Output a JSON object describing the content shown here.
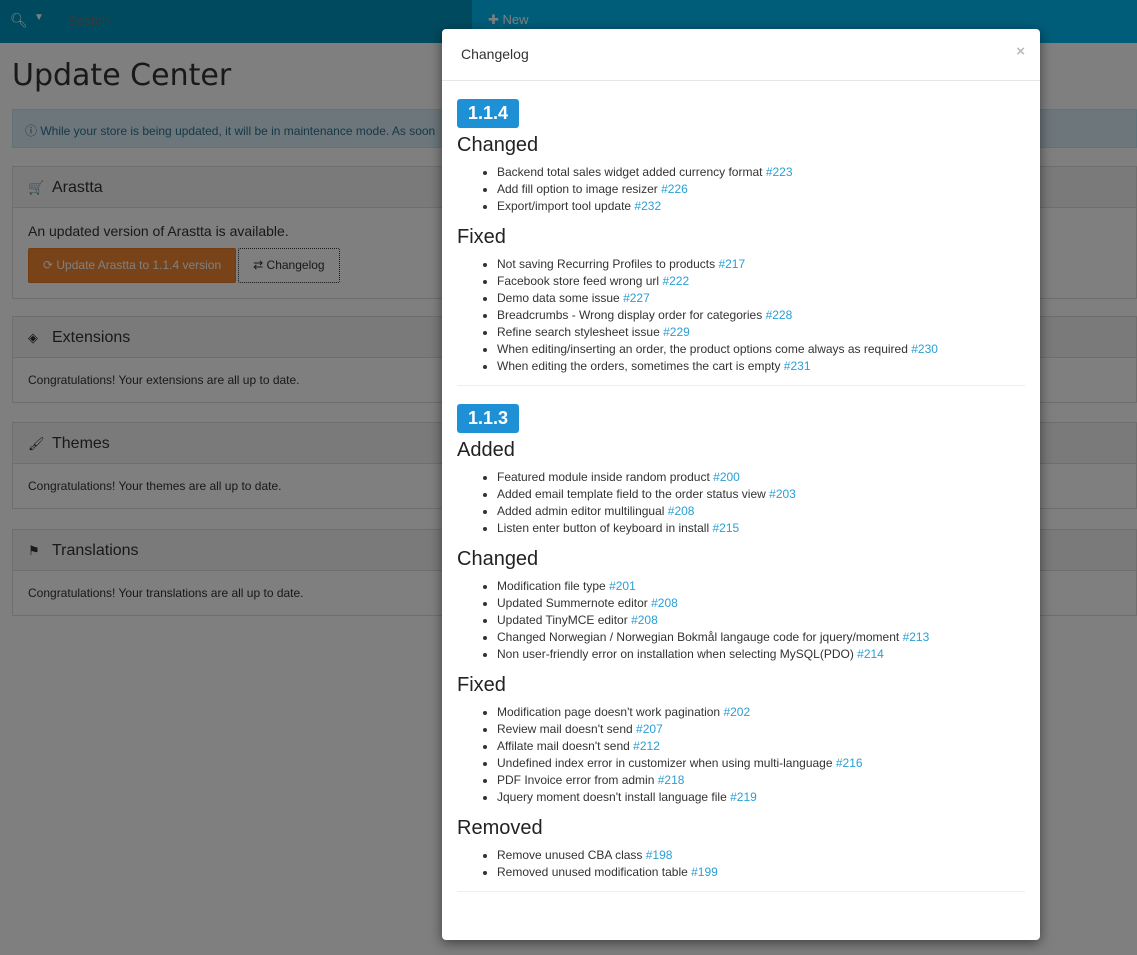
{
  "navbar": {
    "search_placeholder": "Search",
    "new_label": "New"
  },
  "page": {
    "title": "Update Center",
    "alert": "While your store is being updated, it will be in maintenance mode. As soon"
  },
  "panels": [
    {
      "icon": "shopping-cart-icon",
      "glyph": "🛒",
      "title": "Arastta",
      "body": "An updated version of Arastta is available.",
      "update_button": "Update Arastta to 1.1.4 version",
      "changelog_button": "Changelog"
    },
    {
      "icon": "cube-icon",
      "glyph": "◈",
      "title": "Extensions",
      "body": "Congratulations! Your extensions are all up to date."
    },
    {
      "icon": "brush-icon",
      "glyph": "🖌",
      "title": "Themes",
      "body": "Congratulations! Your themes are all up to date."
    },
    {
      "icon": "flag-icon",
      "glyph": "⚑",
      "title": "Translations",
      "body": "Congratulations! Your translations are all up to date."
    }
  ],
  "modal": {
    "title": "Changelog",
    "close": "×",
    "versions": [
      {
        "version": "1.1.4",
        "sections": [
          {
            "title": "Changed",
            "items": [
              {
                "text": "Backend total sales widget added currency format",
                "link": "#223"
              },
              {
                "text": "Add fill option to image resizer",
                "link": "#226"
              },
              {
                "text": "Export/import tool update",
                "link": "#232"
              }
            ]
          },
          {
            "title": "Fixed",
            "items": [
              {
                "text": "Not saving Recurring Profiles to products",
                "link": "#217"
              },
              {
                "text": "Facebook store feed wrong url",
                "link": "#222"
              },
              {
                "text": "Demo data some issue",
                "link": "#227"
              },
              {
                "text": "Breadcrumbs - Wrong display order for categories",
                "link": "#228"
              },
              {
                "text": "Refine search stylesheet issue",
                "link": "#229"
              },
              {
                "text": "When editing/inserting an order, the product options come always as required",
                "link": "#230"
              },
              {
                "text": "When editing the orders, sometimes the cart is empty",
                "link": "#231"
              }
            ]
          }
        ]
      },
      {
        "version": "1.1.3",
        "sections": [
          {
            "title": "Added",
            "items": [
              {
                "text": "Featured module inside random product",
                "link": "#200"
              },
              {
                "text": "Added email template field to the order status view",
                "link": "#203"
              },
              {
                "text": "Added admin editor multilingual",
                "link": "#208"
              },
              {
                "text": "Listen enter button of keyboard in install",
                "link": "#215"
              }
            ]
          },
          {
            "title": "Changed",
            "items": [
              {
                "text": "Modification file type",
                "link": "#201"
              },
              {
                "text": "Updated Summernote editor",
                "link": "#208"
              },
              {
                "text": "Updated TinyMCE editor",
                "link": "#208"
              },
              {
                "text": "Changed Norwegian / Norwegian Bokmål langauge code for jquery/moment",
                "link": "#213"
              },
              {
                "text": "Non user-friendly error on installation when selecting MySQL(PDO)",
                "link": "#214"
              }
            ]
          },
          {
            "title": "Fixed",
            "items": [
              {
                "text": "Modification page doesn't work pagination",
                "link": "#202"
              },
              {
                "text": "Review mail doesn't send",
                "link": "#207"
              },
              {
                "text": "Affilate mail doesn't send",
                "link": "#212"
              },
              {
                "text": "Undefined index error in customizer when using multi-language",
                "link": "#216"
              },
              {
                "text": "PDF Invoice error from admin",
                "link": "#218"
              },
              {
                "text": "Jquery moment doesn't install language file",
                "link": "#219"
              }
            ]
          },
          {
            "title": "Removed",
            "items": [
              {
                "text": "Remove unused CBA class",
                "link": "#198"
              },
              {
                "text": "Removed unused modification table",
                "link": "#199"
              }
            ]
          }
        ]
      }
    ]
  },
  "colors": {
    "navbar": "#0094bf",
    "accent": "#1e91d6",
    "link": "#2a9fd6",
    "update_button": "#f38733"
  }
}
